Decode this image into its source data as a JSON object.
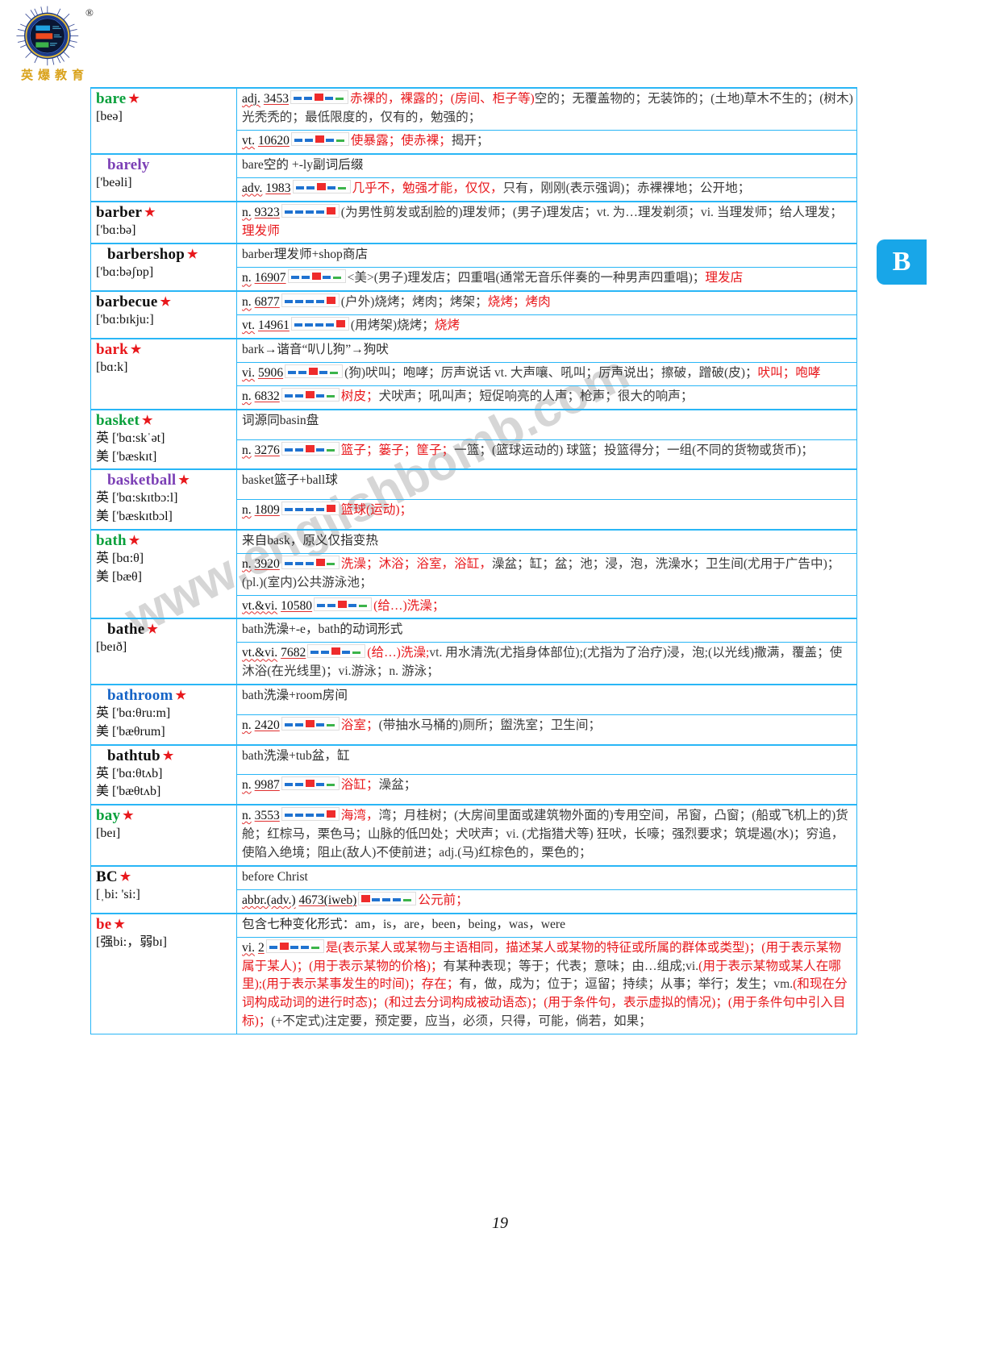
{
  "brand": {
    "registered_mark": "®",
    "chinese_name": "英爆教育"
  },
  "thumb_tab": {
    "letter": "B"
  },
  "page_number": "19",
  "watermark": "www.englishbomb.com",
  "colors": {
    "rule": "#29b6f6",
    "tab_bg": "#18a6e8",
    "red": "#e8181c",
    "green": "#0aa03c",
    "purple": "#7b3fb5",
    "blue_word": "#1463c6",
    "meter_red": "#ef2b2b",
    "meter_blue": "#1f72d0",
    "meter_green": "#3bb44a"
  },
  "entries": [
    {
      "word": "bare",
      "word_color": "green",
      "indent": false,
      "star": true,
      "phonetics": [
        "[beə]"
      ],
      "root": null,
      "senses": [
        {
          "pos": "adj.",
          "rank": "3453",
          "meter": 2,
          "text_red": "赤裸的，裸露的；(房间、柜子等)",
          "text_rest": "空的；无覆盖物的；无装饰的；(土地)草木不生的；(树木)光秃秃的；最低限度的，仅有的，勉强的；"
        },
        {
          "pos": "vt.",
          "rank": "10620",
          "meter": 2,
          "text_red": "使暴露；使赤裸；",
          "text_rest": "揭开；"
        }
      ]
    },
    {
      "word": "barely",
      "word_color": "purple",
      "indent": true,
      "star": false,
      "phonetics": [
        "['beəli]"
      ],
      "root": "bare空的 +-ly副词后缀",
      "senses": [
        {
          "pos": "adv.",
          "rank": "1983",
          "meter": 2,
          "text_red": "几乎不，勉强才能，仅仅，",
          "text_rest": "只有，刚刚(表示强调)；赤裸裸地；公开地；"
        }
      ]
    },
    {
      "word": "barber",
      "word_color": "black",
      "indent": false,
      "star": true,
      "phonetics": [
        "['bɑ:bə]"
      ],
      "root": null,
      "senses": [
        {
          "pos": "n.",
          "rank": "9323",
          "meter": 4,
          "text_red": "",
          "text_rest": "(为男性剪发或刮脸的)理发师；(男子)理发店；vt. 为…理发剃须；vi. 当理发师；给人理发；",
          "red_span": "理发师"
        }
      ]
    },
    {
      "word": "barbershop",
      "word_color": "black",
      "indent": true,
      "star": true,
      "phonetics": [
        "['bɑ:bəʃɒp]"
      ],
      "root": "barber理发师+shop商店",
      "senses": [
        {
          "pos": "n.",
          "rank": "16907",
          "meter": 2,
          "text_red": "",
          "text_rest": "<美>(男子)理发店；四重唱(通常无音乐伴奏的一种男声四重唱)；",
          "red_span": "理发店"
        }
      ]
    },
    {
      "word": "barbecue",
      "word_color": "black",
      "indent": false,
      "star": true,
      "phonetics": [
        "['bɑ:bɪkju:]"
      ],
      "root": null,
      "senses": [
        {
          "pos": "n.",
          "rank": "6877",
          "meter": 4,
          "text_red": "",
          "text_rest": "(户外)烧烤；烤肉；烤架；",
          "red_span": "烧烤；烤肉"
        },
        {
          "pos": "vt.",
          "rank": "14961",
          "meter": 4,
          "text_red": "",
          "text_rest": "(用烤架)烧烤；",
          "red_span": "烧烤"
        }
      ]
    },
    {
      "word": "bark",
      "word_color": "red",
      "indent": false,
      "star": true,
      "phonetics": [
        "[bɑ:k]"
      ],
      "root": "bark→谐音“叭儿狗”→狗吠",
      "senses": [
        {
          "pos": "vi.",
          "rank": "5906",
          "meter": 2,
          "text_red": "",
          "text_rest": "(狗)吠叫；咆哮；厉声说话 vt. 大声嚷、吼叫；厉声说出；擦破，蹭破(皮)；",
          "red_span": "吠叫；咆哮"
        },
        {
          "pos": "n.",
          "rank": "6832",
          "meter": 2,
          "text_red": "树皮；",
          "text_rest": "犬吠声；吼叫声；短促响亮的人声；枪声；很大的响声；"
        }
      ]
    },
    {
      "word": "basket",
      "word_color": "green",
      "indent": false,
      "star": true,
      "phonetics": [
        "英 ['bɑ:skˈət]",
        "美 ['bæskɪt]"
      ],
      "root": "词源同basin盘",
      "senses": [
        {
          "pos": "n.",
          "rank": "3276",
          "meter": 2,
          "text_red": "篮子；篓子；筐子；",
          "text_rest": "一篮；(篮球运动的) 球篮；投篮得分；一组(不同的货物或货币)；"
        }
      ]
    },
    {
      "word": "basketball",
      "word_color": "purple",
      "indent": true,
      "star": true,
      "phonetics": [
        "英 ['bɑ:skɪtbɔ:l]",
        "美 ['bæskɪtbɔl]"
      ],
      "root": "basket篮子+ball球",
      "senses": [
        {
          "pos": "n.",
          "rank": "1809",
          "meter": 4,
          "text_red": "篮球(运动)；",
          "text_rest": ""
        }
      ]
    },
    {
      "word": "bath",
      "word_color": "green",
      "indent": false,
      "star": true,
      "phonetics": [
        "英 [bɑ:θ]",
        "美 [bæθ]"
      ],
      "root": "来自bask，原义仅指变热",
      "senses": [
        {
          "pos": "n.",
          "rank": "3920",
          "meter": 3,
          "text_red": "洗澡；沐浴；浴室，浴缸，",
          "text_rest": "澡盆；缸；盆；池；浸，泡，洗澡水；卫生间(尤用于广告中)；(pl.)(室内)公共游泳池；"
        },
        {
          "pos": "vt.&vi.",
          "rank": "10580",
          "meter": 2,
          "text_red": "(给…)洗澡；",
          "text_rest": ""
        }
      ]
    },
    {
      "word": "bathe",
      "word_color": "black",
      "indent": true,
      "star": true,
      "phonetics": [
        "[beɪð]"
      ],
      "root": "bath洗澡+-e，bath的动词形式",
      "senses": [
        {
          "pos": "vt.&vi.",
          "rank": "7682",
          "meter": 2,
          "text_red": "(给…)洗澡;",
          "text_rest": "vt. 用水清洗(尤指身体部位);(尤指为了治疗)浸，泡;(以光线)撒满，覆盖；使沐浴(在光线里)；vi.游泳；n. 游泳；"
        }
      ]
    },
    {
      "word": "bathroom",
      "word_color": "blue",
      "indent": true,
      "star": true,
      "phonetics": [
        "英 ['bɑ:θru:m]",
        "美 ['bæθrum]"
      ],
      "root": "bath洗澡+room房间",
      "senses": [
        {
          "pos": "n.",
          "rank": "2420",
          "meter": 2,
          "text_red": "浴室；",
          "text_rest": "(带抽水马桶的)厕所；盥洗室；卫生间；",
          "red_span2": "厕所"
        }
      ]
    },
    {
      "word": "bathtub",
      "word_color": "black",
      "indent": true,
      "star": true,
      "phonetics": [
        "英 ['bɑ:θtʌb]",
        "美 ['bæθtʌb]"
      ],
      "root": "bath洗澡+tub盆，缸",
      "senses": [
        {
          "pos": "n.",
          "rank": "9987",
          "meter": 2,
          "text_red": "浴缸；",
          "text_rest": "澡盆；"
        }
      ]
    },
    {
      "word": "bay",
      "word_color": "green",
      "indent": false,
      "star": true,
      "phonetics": [
        "[beɪ]"
      ],
      "root": null,
      "senses": [
        {
          "pos": "n.",
          "rank": "3553",
          "meter": 4,
          "text_red": "海湾，",
          "text_rest": "湾；月桂树；(大房间里面或建筑物外面的)专用空间，吊窗，凸窗；(船或飞机上的)货舱；红棕马，栗色马；山脉的低凹处；犬吠声；vi. (尤指猎犬等) 狂吠，长嚎；强烈要求；筑堤遏(水)；穷追，使陷入绝境；阻止(敌人)不使前进；adj.(马)红棕色的，栗色的；"
        }
      ]
    },
    {
      "word": "BC",
      "word_color": "black",
      "indent": false,
      "star": true,
      "phonetics": [
        "[ˌbi: 'si:]"
      ],
      "root": "before Christ",
      "senses": [
        {
          "pos": "abbr.(adv.)",
          "rank": "4673(iweb)",
          "meter": 0,
          "text_red": "公元前；",
          "text_rest": ""
        }
      ]
    },
    {
      "word": "be",
      "word_color": "red",
      "indent": false,
      "star": true,
      "phonetics": [
        "[强bi:，弱bɪ]"
      ],
      "root": "包含七种变化形式：am，is，are，been，being，was，were",
      "senses": [
        {
          "pos": "vi.",
          "rank": "2",
          "meter": 1,
          "text_red": "是(表示某人或某物与主语相同，描述某人或某物的特征或所属的群体或类型)；(用于表示某物属于某人)；(用于表示某物的价格)；",
          "text_rest": "有某种表现；等于；代表；意味；由…组成;vi.",
          "text_red2": "(用于表示某物或某人在哪里);(用于表示某事发生的时间)；存在；",
          "text_rest2": "有，做，成为；位于；逗留；持续；从事；举行；发生；vm.",
          "text_red3": "(和现在分词构成动词的进行时态)；(和过去分词构成被动语态)；(用于条件句，表示虚拟的情况)；(用于条件句中引入目标)；",
          "text_rest3": "(+不定式)注定要，预定要，应当，必须，只得，可能，倘若，如果；"
        }
      ]
    }
  ]
}
